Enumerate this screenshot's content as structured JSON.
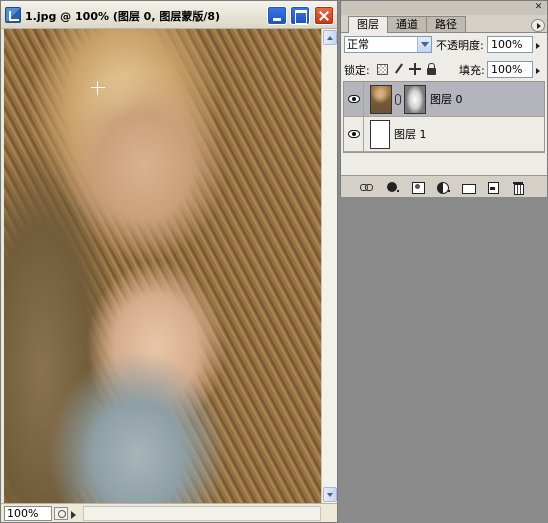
{
  "document": {
    "title": "1.jpg @ 100% (图层 0, 图层蒙版/8)",
    "zoom": "100%"
  },
  "layers_palette": {
    "tabs": [
      {
        "label": "图层",
        "active": true
      },
      {
        "label": "通道",
        "active": false
      },
      {
        "label": "路径",
        "active": false
      }
    ],
    "blend_mode": "正常",
    "opacity_label": "不透明度:",
    "opacity_value": "100%",
    "lock_label": "锁定:",
    "fill_label": "填充:",
    "fill_value": "100%",
    "layers": [
      {
        "name": "图层 0",
        "visible": true,
        "selected": true,
        "has_mask": true
      },
      {
        "name": "图层 1",
        "visible": true,
        "selected": false,
        "has_mask": false
      }
    ],
    "footer_icons": [
      "link-icon",
      "fx-icon",
      "mask-icon",
      "adjustment-icon",
      "folder-icon",
      "new-layer-icon",
      "trash-icon"
    ]
  },
  "colors": {
    "workspace": "#8a8a8a",
    "selected_layer": "#b4b4bc",
    "close_button": "#c63618",
    "window_button": "#1c4fc0"
  }
}
